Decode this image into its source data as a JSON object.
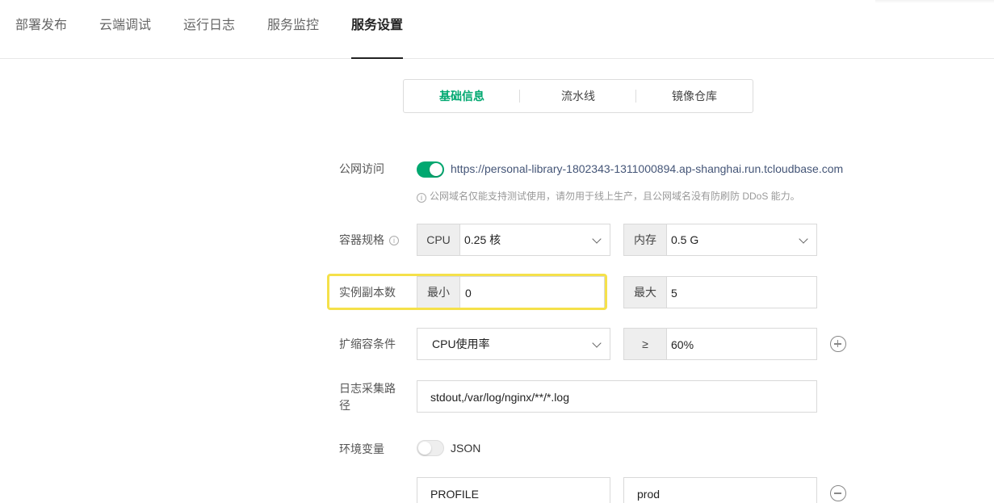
{
  "top_tabs": [
    {
      "label": "部署发布"
    },
    {
      "label": "云端调试"
    },
    {
      "label": "运行日志"
    },
    {
      "label": "服务监控"
    },
    {
      "label": "服务设置",
      "active": true
    }
  ],
  "sub_tabs": [
    {
      "label": "基础信息",
      "active": true
    },
    {
      "label": "流水线"
    },
    {
      "label": "镜像仓库"
    }
  ],
  "public_access": {
    "label": "公网访问",
    "enabled": true,
    "url": "https://personal-library-1802343-1311000894.ap-shanghai.run.tcloudbase.com",
    "hint": "公网域名仅能支持测试使用，请勿用于线上生产，且公网域名没有防刷防 DDoS 能力。",
    "hint_icon": "info-icon"
  },
  "container_spec": {
    "label": "容器规格",
    "info_icon": "info-icon",
    "cpu_addon": "CPU",
    "cpu_value": "0.25 核",
    "mem_addon": "内存",
    "mem_value": "0.5 G"
  },
  "replicas": {
    "label": "实例副本数",
    "min_addon": "最小",
    "min_value": "0",
    "max_addon": "最大",
    "max_value": "5"
  },
  "scaling": {
    "label": "扩缩容条件",
    "metric": "CPU使用率",
    "op_addon": "≥",
    "threshold": "60%",
    "add_icon": "plus-circle-icon"
  },
  "log_path": {
    "label_line1": "日志采集路",
    "label_line2": "径",
    "value": "stdout,/var/log/nginx/**/*.log"
  },
  "env_vars": {
    "label": "环境变量",
    "json_enabled": false,
    "json_label": "JSON",
    "rows": [
      {
        "key": "PROFILE",
        "value": "prod"
      }
    ],
    "remove_icon": "minus-circle-icon"
  },
  "colors": {
    "accent": "#00a870",
    "highlight": "#f5e14a"
  }
}
